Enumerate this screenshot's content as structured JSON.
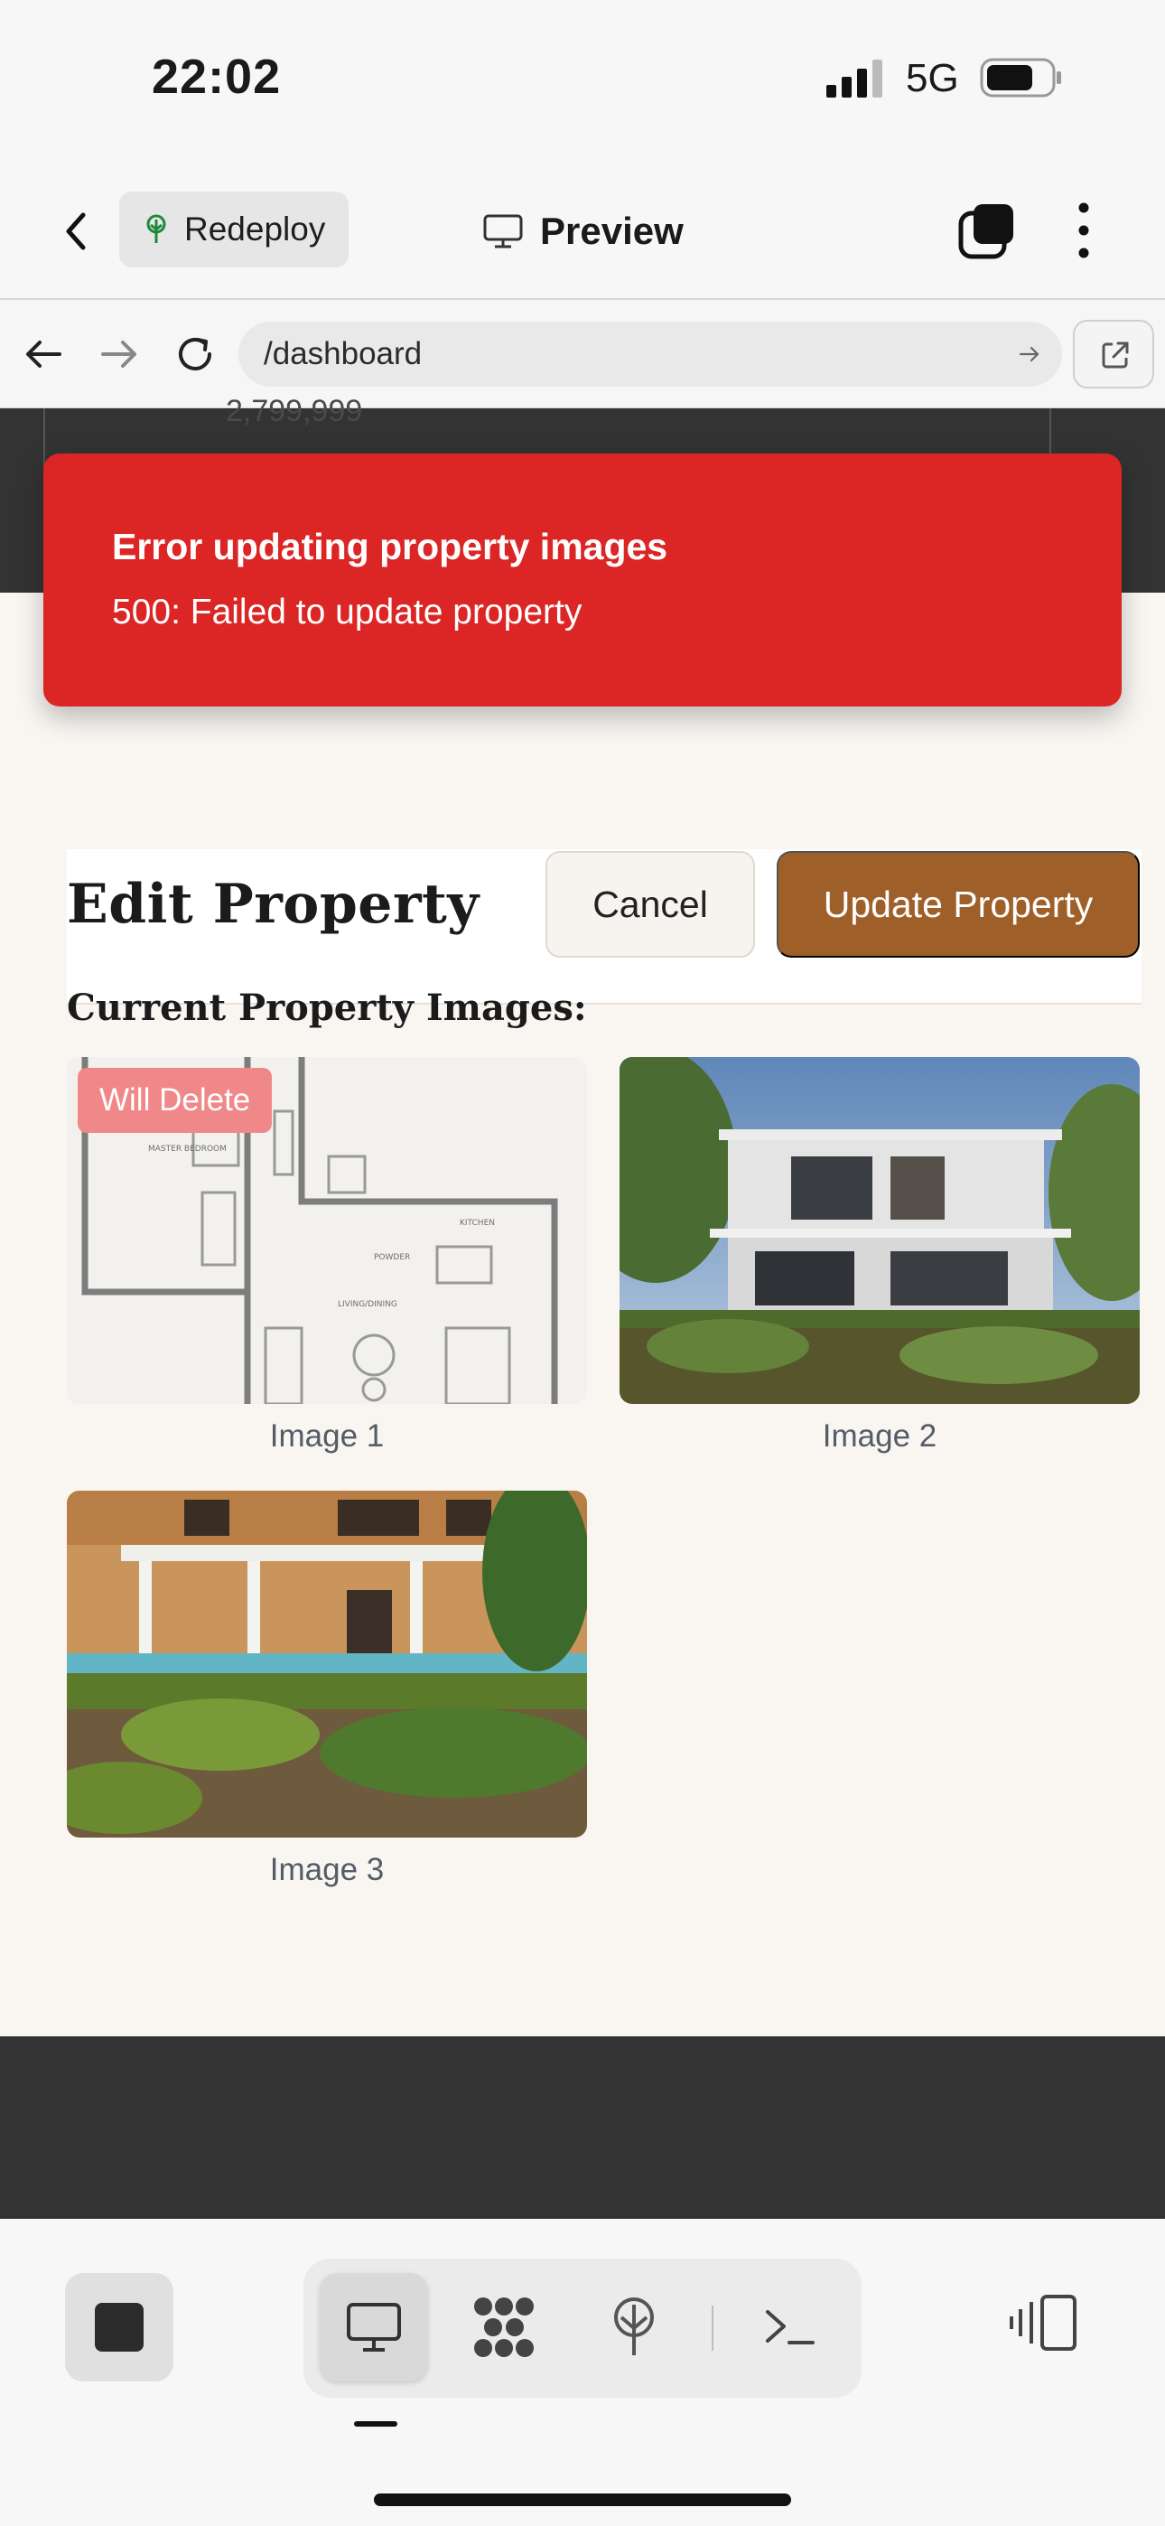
{
  "status_bar": {
    "time": "22:02",
    "network": "5G"
  },
  "header": {
    "redeploy_label": "Redeploy",
    "preview_label": "Preview"
  },
  "browser": {
    "url": "/dashboard"
  },
  "background": {
    "price_text": "2,799,999"
  },
  "toast": {
    "title": "Error updating property images",
    "message": "500: Failed to update property"
  },
  "edit": {
    "title": "Edit Property",
    "cancel_label": "Cancel",
    "update_label": "Update Property",
    "section_label": "Current Property Images:"
  },
  "images": [
    {
      "caption": "Image 1",
      "badge": "Will Delete",
      "content": "floor-plan"
    },
    {
      "caption": "Image 2",
      "content": "modern-villa"
    },
    {
      "caption": "Image 3",
      "content": "villa-garden-pool"
    }
  ],
  "colors": {
    "toast_bg": "#dc2626",
    "primary_button": "#9f5f29",
    "delete_badge": "#f0888a",
    "backdrop": "#333333",
    "page_bg": "#f9f6f2"
  },
  "icons": [
    "chevron-left-icon",
    "redeploy-tree-icon",
    "monitor-icon",
    "tabs-icon",
    "kebab-icon",
    "arrow-left-icon",
    "arrow-right-icon",
    "reload-icon",
    "external-link-icon",
    "stop-icon",
    "grid-icon",
    "terminal-icon",
    "panel-icon"
  ]
}
